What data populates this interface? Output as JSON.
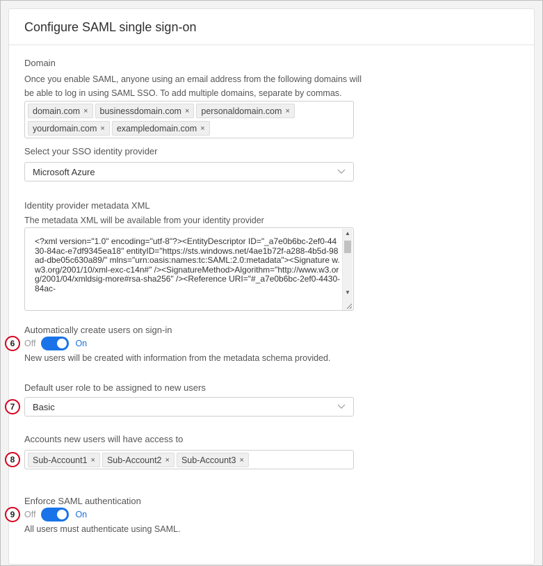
{
  "title": "Configure SAML single sign-on",
  "domain": {
    "label": "Domain",
    "help": "Once you enable SAML, anyone using an email address from the following domains will be able to log in using SAML SSO. To add multiple domains, separate by commas.",
    "tags": [
      "domain.com",
      "businessdomain.com",
      "personaldomain.com",
      "yourdomain.com",
      "exampledomain.com"
    ]
  },
  "idp": {
    "label": "Select your SSO identity provider",
    "value": "Microsoft Azure"
  },
  "metadata": {
    "label": "Identity provider metadata XML",
    "help": "The metadata XML will be available from your identity provider",
    "value": "<?xml version=\"1.0\" encoding=\"utf-8\"?><EntityDescriptor ID=\"_a7e0b6bc-2ef0-4430-84ac-e7df9345ea18\" entityID=\"https://sts.windows.net/4ae1b72f-a288-4b5d-98ad-dbe05c630a89/\" mlns=\"urn:oasis:names:tc:SAML:2.0:metadata\"><Signature w.w3.org/2001/10/xml-exc-c14n#\" /><SignatureMethod>Algorithm=\"http://www.w3.org/2001/04/xmldsig-more#rsa-sha256\" /><Reference URI=\"#_a7e0b6bc-2ef0-4430-84ac-"
  },
  "auto_create": {
    "label": "Automatically create users on sign-in",
    "off": "Off",
    "on": "On",
    "help": "New users will be created with information from the metadata schema provided."
  },
  "role": {
    "label": "Default user role to be assigned to new users",
    "value": "Basic"
  },
  "accounts": {
    "label": "Accounts new users will have access to",
    "tags": [
      "Sub-Account1",
      "Sub-Account2",
      "Sub-Account3"
    ]
  },
  "enforce": {
    "label": "Enforce SAML authentication",
    "off": "Off",
    "on": "On",
    "help": "All users must authenticate using SAML."
  },
  "callouts": [
    "6",
    "7",
    "8",
    "9"
  ],
  "colors": {
    "accent": "#1a73e8",
    "callout": "#d6001c"
  },
  "icons": {
    "remove": "×",
    "dropdown": "chevron-down-icon"
  }
}
